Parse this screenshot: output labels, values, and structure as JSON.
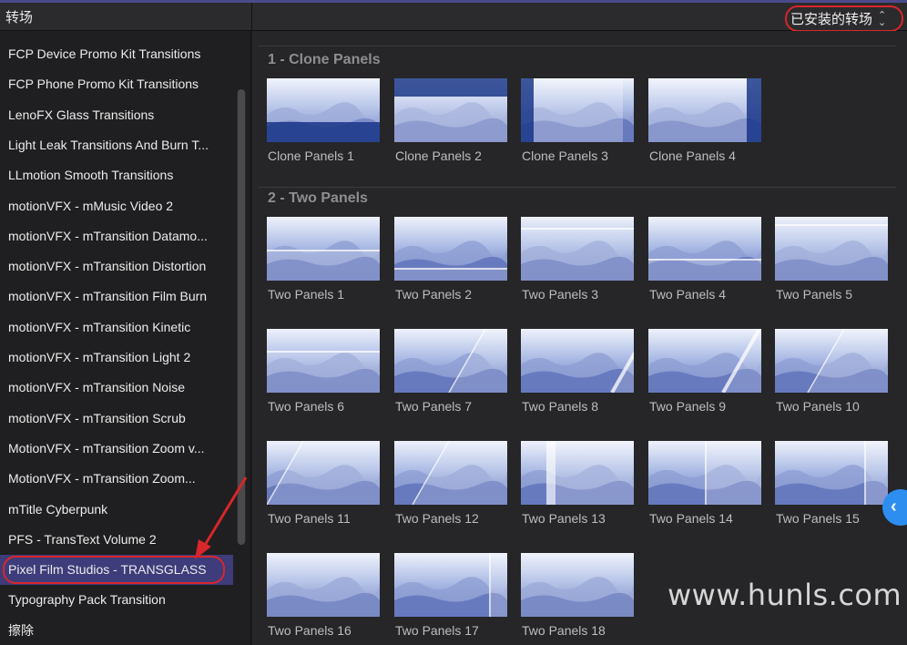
{
  "header": {
    "left_title": "转场",
    "filter_label": "已安装的转场"
  },
  "sidebar": {
    "items": [
      {
        "label": "FCP Device Promo Kit Transitions",
        "selected": false
      },
      {
        "label": "FCP Phone Promo Kit Transitions",
        "selected": false
      },
      {
        "label": "LenoFX Glass Transitions",
        "selected": false
      },
      {
        "label": "Light Leak Transitions And Burn T...",
        "selected": false
      },
      {
        "label": "LLmotion Smooth Transitions",
        "selected": false
      },
      {
        "label": "motionVFX - mMusic Video 2",
        "selected": false
      },
      {
        "label": "motionVFX - mTransition Datamo...",
        "selected": false
      },
      {
        "label": "motionVFX - mTransition Distortion",
        "selected": false
      },
      {
        "label": "motionVFX - mTransition Film Burn",
        "selected": false
      },
      {
        "label": "motionVFX - mTransition Kinetic",
        "selected": false
      },
      {
        "label": "motionVFX - mTransition Light 2",
        "selected": false
      },
      {
        "label": "motionVFX - mTransition Noise",
        "selected": false
      },
      {
        "label": "motionVFX - mTransition Scrub",
        "selected": false
      },
      {
        "label": "MotionVFX - mTransition Zoom v...",
        "selected": false
      },
      {
        "label": "MotionVFX - mTransition Zoom...",
        "selected": false
      },
      {
        "label": "mTitle Cyberpunk",
        "selected": false
      },
      {
        "label": "PFS - TransText Volume 2",
        "selected": false
      },
      {
        "label": "Pixel Film Studios - TRANSGLASS",
        "selected": true
      },
      {
        "label": "Typography Pack Transition",
        "selected": false
      },
      {
        "label": "擦除",
        "selected": false
      }
    ]
  },
  "sections": [
    {
      "title": "1 - Clone Panels",
      "items": [
        "Clone Panels 1",
        "Clone Panels 2",
        "Clone Panels 3",
        "Clone Panels 4"
      ]
    },
    {
      "title": "2 - Two Panels",
      "items": [
        "Two Panels 1",
        "Two Panels 2",
        "Two Panels 3",
        "Two Panels 4",
        "Two Panels 5",
        "Two Panels 6",
        "Two Panels 7",
        "Two Panels 8",
        "Two Panels 9",
        "Two Panels 10",
        "Two Panels 11",
        "Two Panels 12",
        "Two Panels 13",
        "Two Panels 14",
        "Two Panels 15",
        "Two Panels 16",
        "Two Panels 17",
        "Two Panels 18"
      ]
    }
  ],
  "collapse_button_glyph": "‹",
  "watermark": "www.hunls.com",
  "colors": {
    "selection": "#3e3c7a",
    "annotation_red": "#d8262a",
    "accent_blue": "#2d8ef0"
  }
}
